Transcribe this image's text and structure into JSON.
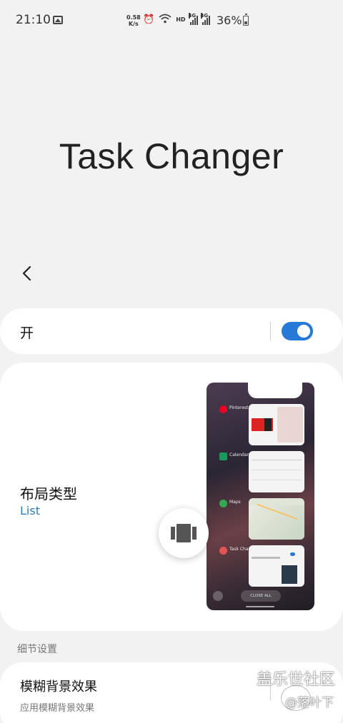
{
  "status_bar": {
    "time": "21:10",
    "net_speed_value": "0.58",
    "net_speed_unit": "K/s",
    "hd": "HD",
    "net_type_1": "4G",
    "net_type_2": "4G",
    "battery_pct": "36%",
    "icons": [
      "image-icon",
      "alarm-icon",
      "wifi-icon",
      "signal-icon",
      "signal-icon",
      "battery-icon"
    ]
  },
  "header": {
    "title": "Task Changer",
    "back_icon": "chevron-left-icon"
  },
  "master_switch": {
    "label": "开",
    "enabled": true,
    "accent": "#2779d8"
  },
  "layout_type": {
    "title": "布局类型",
    "value": "List",
    "value_color": "#2a7fb8",
    "preview": {
      "apps": [
        {
          "name": "Pinterest",
          "color": "#e60023"
        },
        {
          "name": "Calendar",
          "color": "#1a9a5a"
        },
        {
          "name": "Maps",
          "color": "#34a853"
        },
        {
          "name": "Task Changer",
          "color": "#e35555"
        }
      ],
      "close_all": "CLOSE ALL"
    }
  },
  "details_section": {
    "header": "细节设置"
  },
  "blur_background": {
    "title": "模糊背景效果",
    "subtitle": "应用模糊背景效果"
  },
  "watermark": {
    "line1": "盖乐世社区",
    "line2": "@落叶下"
  }
}
